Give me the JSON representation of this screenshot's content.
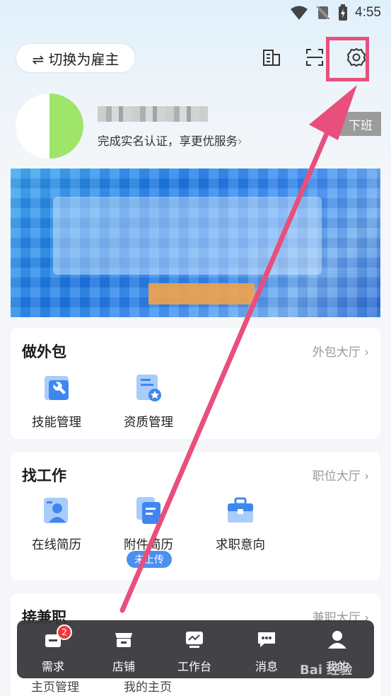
{
  "status_bar": {
    "time": "4:55"
  },
  "header": {
    "switch_label": "⇌ 切换为雇主",
    "icons": [
      "building-icon",
      "scan-icon",
      "settings-icon"
    ]
  },
  "profile": {
    "verify_text": "完成实名认证，享更优服务",
    "chevron": "›",
    "duty_label": "下班"
  },
  "outsourcing": {
    "title": "做外包",
    "link": "外包大厅 ›",
    "items": [
      {
        "label": "技能管理",
        "icon": "skill-management-icon"
      },
      {
        "label": "资质管理",
        "icon": "qualification-management-icon"
      }
    ]
  },
  "jobs": {
    "title": "找工作",
    "link": "职位大厅 ›",
    "items": [
      {
        "label": "在线简历",
        "icon": "online-resume-icon"
      },
      {
        "label": "附件简历",
        "icon": "attachment-resume-icon",
        "badge": "未上传"
      },
      {
        "label": "求职意向",
        "icon": "job-intention-icon"
      }
    ]
  },
  "parttime": {
    "title": "接兼职",
    "link": "兼职大厅 ›",
    "items": [
      {
        "label": "主页管理"
      },
      {
        "label": "我的主页"
      }
    ]
  },
  "tabbar": {
    "items": [
      {
        "label": "需求",
        "icon": "demand-icon",
        "badge": "2"
      },
      {
        "label": "店铺",
        "icon": "shop-icon"
      },
      {
        "label": "工作台",
        "icon": "workbench-icon"
      },
      {
        "label": "消息",
        "icon": "message-icon"
      },
      {
        "label": "我的",
        "icon": "profile-icon"
      }
    ]
  },
  "watermark": "Bai 经验",
  "colors": {
    "highlight": "#e94f7c",
    "accent": "#4c8ff0",
    "avatar_green": "#9ee56a"
  }
}
